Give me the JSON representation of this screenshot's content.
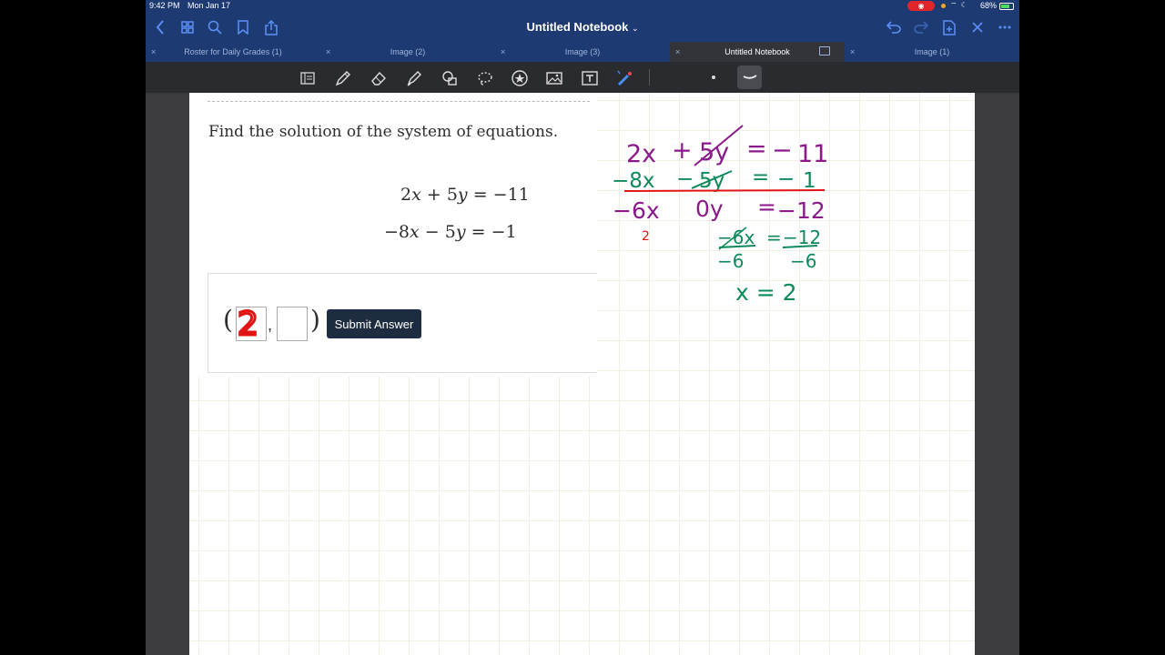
{
  "status_bar": {
    "time": "9:42 PM",
    "date": "Mon Jan 17",
    "battery": "68%"
  },
  "nav": {
    "title": "Untitled Notebook",
    "left_icons": [
      "back-icon",
      "grid-icon",
      "search-icon",
      "bookmark-icon",
      "share-icon"
    ],
    "right_icons": [
      "undo-icon",
      "redo-icon",
      "add-page-icon",
      "close-icon",
      "more-icon"
    ]
  },
  "tabs": [
    {
      "label": "Roster for Daily Grades (1)",
      "active": false
    },
    {
      "label": "Image (2)",
      "active": false
    },
    {
      "label": "Image (3)",
      "active": false
    },
    {
      "label": "Untitled Notebook",
      "active": true
    },
    {
      "label": "Image (1)",
      "active": false
    }
  ],
  "tools": [
    "lasso-layout-icon",
    "pen-icon",
    "eraser-icon",
    "highlighter-icon",
    "shapes-icon",
    "lasso-icon",
    "sticker-icon",
    "image-icon",
    "text-icon",
    "laser-pointer-icon"
  ],
  "content": {
    "question": "Find the solution of the system of equations.",
    "eq1": {
      "a": "2",
      "b": "5",
      "op": "+",
      "rhs": "−11"
    },
    "eq2": {
      "a": "−8",
      "b": "5",
      "op": "−",
      "rhs": "−1"
    },
    "answer": {
      "x_value": "",
      "y_value": "",
      "submit_label": "Submit Answer"
    }
  },
  "handwriting": {
    "line1": [
      "2x",
      "+",
      "5y",
      "=",
      "−",
      "11"
    ],
    "line2": [
      "−8x",
      "−",
      "5y",
      "=",
      "−",
      "1"
    ],
    "line3": [
      "−6x",
      "0y",
      "=",
      "−12"
    ],
    "note_small": "2",
    "div_num_left": "−6x",
    "div_den_left": "−6",
    "div_num_right": "−12",
    "div_den_right": "−6",
    "div_eq": "=",
    "result": "x = 2",
    "red_answer": "2",
    "colors": {
      "purple": "#8a1a8a",
      "green": "#0e8a5a",
      "red": "#e01414"
    }
  }
}
